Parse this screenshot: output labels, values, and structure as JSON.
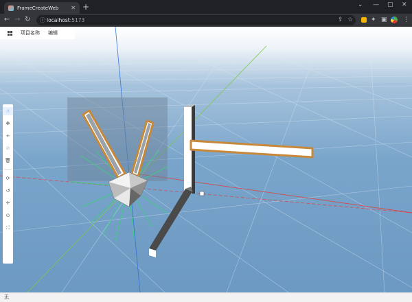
{
  "browser": {
    "tab_title": "FrameCreateWeb",
    "tab_close": "✕",
    "new_tab": "+",
    "url_host": "localhost",
    "url_port": ":5173",
    "window_controls": [
      "⌄",
      "—",
      "▢",
      "✕"
    ]
  },
  "app": {
    "menu": [
      "项目名称",
      "编辑"
    ],
    "tools": [
      "select",
      "move",
      "add",
      "delete-disabled",
      "delete",
      "rotate",
      "undo",
      "move-axes",
      "focus",
      "fit"
    ],
    "status_text": "无"
  },
  "colors": {
    "sky": "#6f9cc4",
    "grid_line": "#d8e6f3",
    "x_axis": "#d24b4b",
    "y_axis": "#7ec84a",
    "z_axis": "#2f6fd8",
    "highlight_outline": "#c8883a"
  }
}
